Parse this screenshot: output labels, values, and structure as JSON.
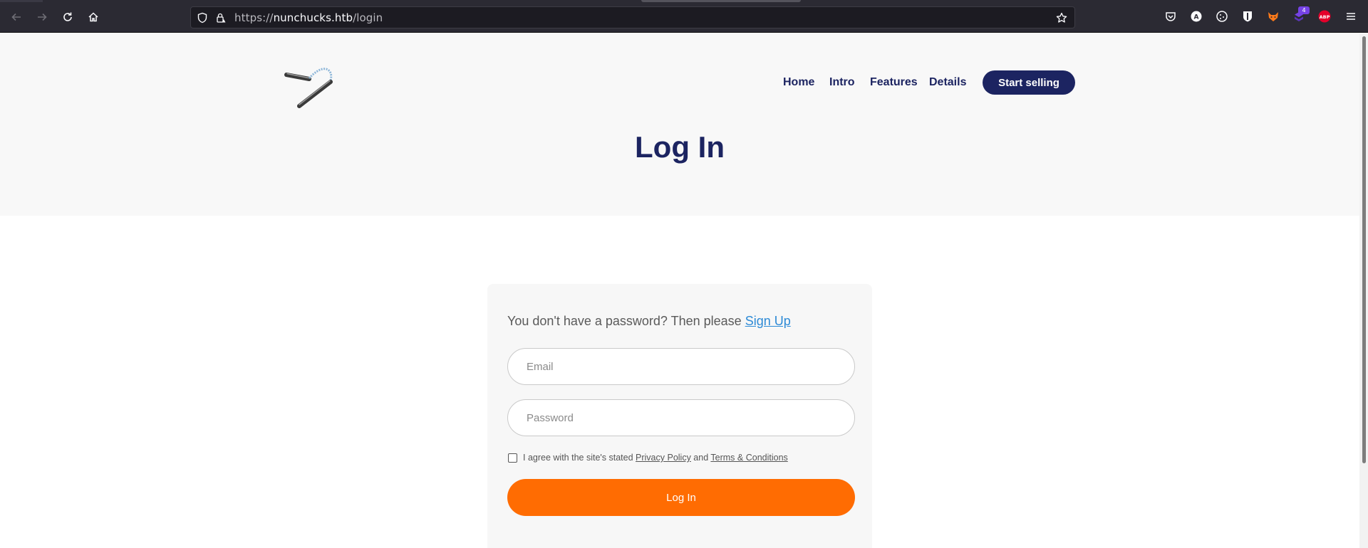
{
  "browser": {
    "url_scheme": "https://",
    "url_host": "nunchucks.htb",
    "url_path": "/login",
    "extension_badge": "4",
    "icons": [
      "back-icon",
      "forward-icon",
      "reload-icon",
      "home-icon",
      "shield-icon",
      "lock-warning-icon",
      "bookmark-star-icon",
      "pocket-icon",
      "account-icon",
      "cookie-icon",
      "privacy-badger-icon",
      "foxyproxy-icon",
      "extension-icon",
      "adblock-plus-icon",
      "menu-icon"
    ],
    "adblock_label": "ABP",
    "account_label": "A"
  },
  "header": {
    "nav": [
      "Home",
      "Intro",
      "Features",
      "Details"
    ],
    "cta_label": "Start selling"
  },
  "hero": {
    "title": "Log In"
  },
  "form": {
    "signup_prompt": "You don't have a password? Then please ",
    "signup_link": "Sign Up",
    "email_placeholder": "Email",
    "password_placeholder": "Password",
    "terms_prefix": "I agree with the site's stated ",
    "privacy_link": "Privacy Policy",
    "terms_and": " and ",
    "terms_link": "Terms & Conditions",
    "checkbox_checked": false,
    "submit_label": "Log In"
  },
  "colors": {
    "navy": "#1c2461",
    "orange": "#ff6c02",
    "link_blue": "#2d8ad6",
    "chrome_bg": "#2b2a33"
  }
}
